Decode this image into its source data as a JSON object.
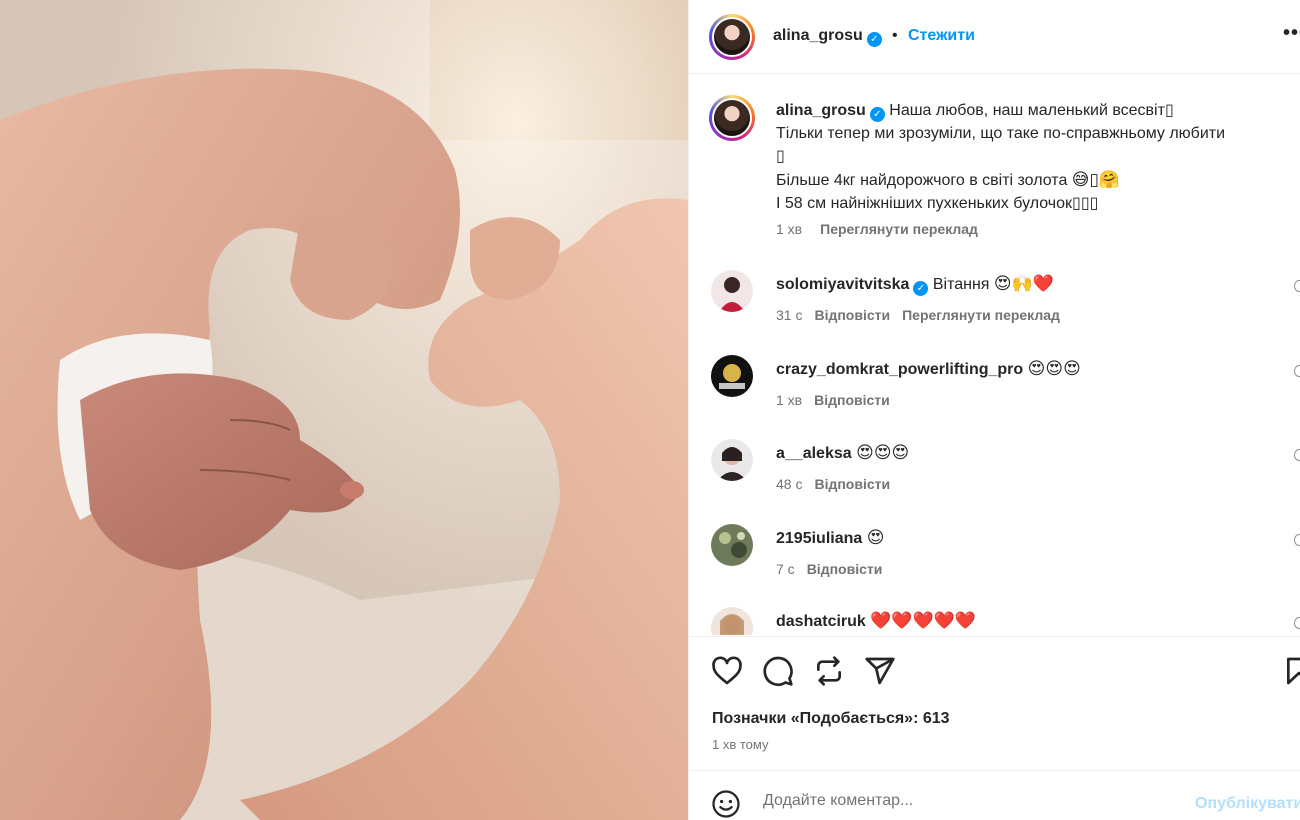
{
  "post": {
    "image_alt_icon": "photo-of-heart-shaped-hands",
    "username": "alina_grosu",
    "verified_icon": "verified-badge-icon",
    "separator": "•",
    "follow_label": "Стежити",
    "more_icon": "more-options-icon"
  },
  "caption": {
    "username": "alina_grosu",
    "text_line1": "Наша любов, наш маленький всесвіт",
    "line1_end": "▯",
    "text_line2": "Тільки тепер ми зрозуміли, що таке по-справжньому любити",
    "line2_end": "▯",
    "text_line3": "Більше 4кг найдорожчого в світі золота",
    "line3_emoji": "😅▯🤗",
    "text_line4": "І 58 см найніжніших пухкеньких булочок",
    "line4_end": "▯▯▯",
    "time": "1 хв",
    "translate_label": "Переглянути переклад"
  },
  "comments": [
    {
      "username": "solomiyavitvitska",
      "verified": true,
      "text": "Вітання",
      "emoji": "😍🙌❤️",
      "time": "31 с",
      "reply_label": "Відповісти",
      "translate_label": "Переглянути переклад"
    },
    {
      "username": "crazy_domkrat_powerlifting_pro",
      "verified": false,
      "text": "",
      "emoji": "😍😍😍",
      "time": "1 хв",
      "reply_label": "Відповісти"
    },
    {
      "username": "a__aleksa",
      "verified": false,
      "text": "",
      "emoji": "😍😍😍",
      "time": "48 с",
      "reply_label": "Відповісти"
    },
    {
      "username": "2195iuliana",
      "verified": false,
      "text": "",
      "emoji": "😍",
      "time": "7 с",
      "reply_label": "Відповісти"
    },
    {
      "username": "dashatciruk",
      "verified": false,
      "text": "",
      "emoji": "❤️❤️❤️❤️❤️",
      "time": "",
      "reply_label": ""
    }
  ],
  "actions": {
    "like_icon": "heart-icon",
    "comment_icon": "comment-icon",
    "repost_icon": "repost-icon",
    "share_icon": "share-icon",
    "save_icon": "bookmark-icon",
    "likes_text": "Позначки «Подобається»: 613",
    "time_ago": "1 хв тому"
  },
  "add_comment": {
    "emoji_icon": "smiley-icon",
    "placeholder": "Додайте коментар...",
    "publish_label": "Опублікувати"
  },
  "colors": {
    "link_blue": "#0095f6",
    "publish_disabled": "#b2dffc",
    "secondary_text": "#737373",
    "heart_red": "#ed4956"
  }
}
